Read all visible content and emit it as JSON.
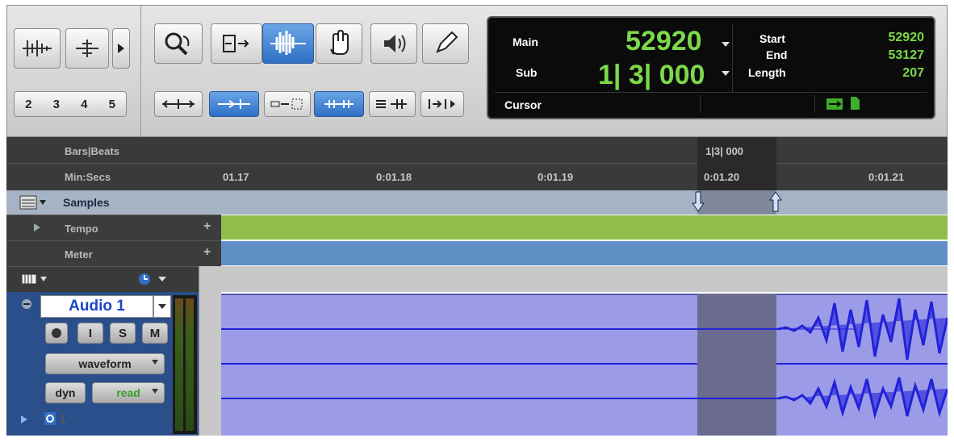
{
  "toolbar": {
    "num_buttons": [
      "2",
      "3",
      "4",
      "5"
    ],
    "mode_buttons": [
      "zoom-tool",
      "trim-tool",
      "selector-tool",
      "grabber-tool",
      "scrub-tool",
      "pencil-tool"
    ],
    "counter": {
      "main_label": "Main",
      "main_value": "52920",
      "sub_label": "Sub",
      "sub_value": "1| 3| 000",
      "cursor_label": "Cursor",
      "start_label": "Start",
      "end_label": "End",
      "length_label": "Length",
      "start_value": "52920",
      "end_value": "53127",
      "length_value": "207"
    }
  },
  "rulers": {
    "bars_beats_label": "Bars|Beats",
    "min_secs_label": "Min:Secs",
    "samples_label": "Samples",
    "tempo_label": "Tempo",
    "meter_label": "Meter",
    "selection_bars": "1|3| 000",
    "min_secs_ticks": [
      "01.17",
      "0:01.18",
      "0:01.19",
      "0:01.20",
      "0:01.21"
    ]
  },
  "track": {
    "name": "Audio 1",
    "record_label": "",
    "input_label": "I",
    "solo_label": "S",
    "mute_label": "M",
    "view_value": "waveform",
    "automation_label": "dyn",
    "automation_mode": "read"
  },
  "colors": {
    "tempo": "#8fbf4a",
    "meter": "#5f8fc4",
    "samples_row": "#a6b3c4",
    "waveform_bg": "#9b9be8",
    "waveform": "#2222d8",
    "selection": "#6b6b8f",
    "counter_green": "#7cd94a"
  }
}
